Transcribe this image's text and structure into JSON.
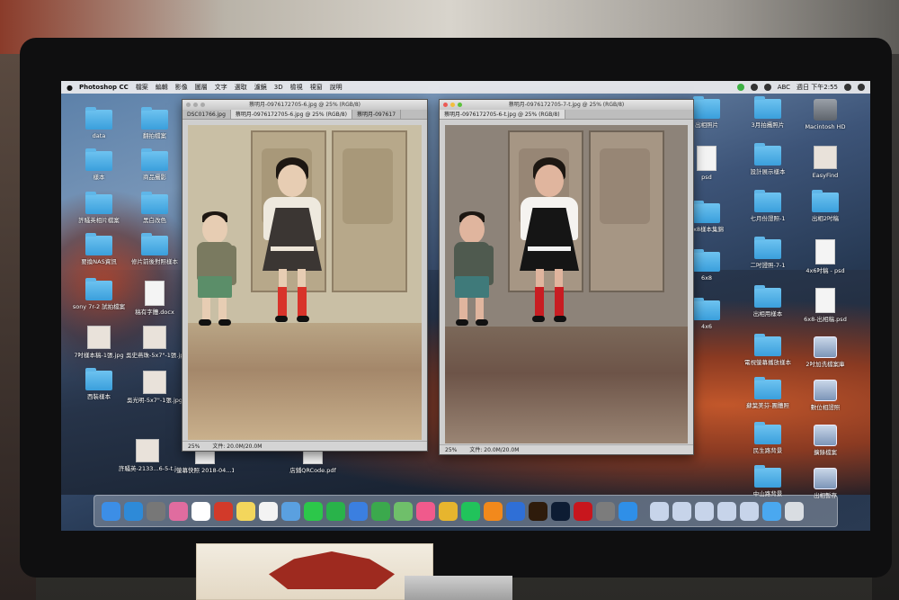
{
  "menubar": {
    "app_name": "Photoshop CC",
    "items": [
      "檔案",
      "編輯",
      "影像",
      "圖層",
      "文字",
      "選取",
      "濾鏡",
      "3D",
      "檢視",
      "視窗",
      "說明"
    ],
    "status_text": "週日 下午2:55",
    "input_label": "ABC"
  },
  "desktop_left": [
    {
      "label": "data",
      "kind": "folder"
    },
    {
      "label": "翻拍檔案",
      "kind": "folder"
    },
    {
      "label": "樣本",
      "kind": "folder"
    },
    {
      "label": "商品攝影",
      "kind": "folder"
    },
    {
      "label": "許騷英相片檔案",
      "kind": "folder"
    },
    {
      "label": "黑白改色",
      "kind": "folder"
    },
    {
      "label": "要換NAS資訊",
      "kind": "folder"
    },
    {
      "label": "修片前後對照樣本",
      "kind": "folder"
    },
    {
      "label": "sony 7r-2 試拍檔案",
      "kind": "folder"
    },
    {
      "label": "稿有字體.docx",
      "kind": "doc"
    },
    {
      "label": "7吋樣本稿-1張.jpg",
      "kind": "thumb"
    },
    {
      "label": "吳史燕珠-5x7\"-1張.jpg",
      "kind": "thumb"
    },
    {
      "label": "西裝樣本",
      "kind": "folder"
    },
    {
      "label": "吳光明-5x7\"-1張.jpg",
      "kind": "thumb"
    },
    {
      "label": "許騷英-2133...6-5-t.jpg",
      "kind": "thumb"
    },
    {
      "label": "螢幕快照 2018-04...1.38.png",
      "kind": "doc"
    },
    {
      "label": "店鋪QRCode.pdf",
      "kind": "doc"
    }
  ],
  "desktop_right": [
    {
      "label": "出相照片",
      "kind": "folder"
    },
    {
      "label": "3月拍攝照片",
      "kind": "folder"
    },
    {
      "label": "Macintosh HD",
      "kind": "drive"
    },
    {
      "label": "psd",
      "kind": "doc"
    },
    {
      "label": "設計展示樣本",
      "kind": "folder"
    },
    {
      "label": "EasyFind",
      "kind": "thumb"
    },
    {
      "label": "6x8樣本集錦",
      "kind": "folder"
    },
    {
      "label": "七月份證照-1",
      "kind": "folder"
    },
    {
      "label": "出相2吋稿",
      "kind": "folder"
    },
    {
      "label": "6x8",
      "kind": "folder"
    },
    {
      "label": "二吋證照-7-1",
      "kind": "folder"
    },
    {
      "label": "4x6吋稿 - psd",
      "kind": "doc"
    },
    {
      "label": "4x6",
      "kind": "folder"
    },
    {
      "label": "出相用樣本",
      "kind": "folder"
    },
    {
      "label": "6x8-出相稿.psd",
      "kind": "doc"
    },
    {
      "label": "電視螢幕播放樣本",
      "kind": "folder"
    },
    {
      "label": "2吋加洗檔案庫",
      "kind": "netvol"
    },
    {
      "label": "蘇葉美芬-團體照",
      "kind": "folder"
    },
    {
      "label": "數位相證照",
      "kind": "netvol"
    },
    {
      "label": "民生路背景",
      "kind": "folder"
    },
    {
      "label": "擴錄檔案",
      "kind": "netvol"
    },
    {
      "label": "中山路背景",
      "kind": "folder"
    },
    {
      "label": "出相暫存",
      "kind": "netvol"
    }
  ],
  "window_left": {
    "title": "蔡明月-0976172705-6.jpg @ 25% (RGB/8)",
    "tabs": [
      "DSC01766.jpg",
      "蔡明月-0976172705-6.jpg @ 25% (RGB/8)",
      "蔡明月-097617"
    ],
    "zoom": "25%",
    "doc_info": "文件: 20.0M/20.0M"
  },
  "window_right": {
    "title": "蔡明月-0976172705-7-t.jpg @ 25% (RGB/8)",
    "tabs": [
      "蔡明月-0976172705-6-t.jpg @ 25% (RGB/8)"
    ],
    "zoom": "25%",
    "doc_info": "文件: 20.0M/20.0M"
  },
  "dock": {
    "apps": [
      "finder-icon",
      "safari-icon",
      "launchpad-icon",
      "photos-icon",
      "calendar-icon",
      "acrobat-icon",
      "notes-icon",
      "reminders-icon",
      "preview-icon",
      "messages-icon",
      "facetime-icon",
      "keynote-icon",
      "numbers-icon",
      "maps-icon",
      "music-icon",
      "chrome-icon",
      "line-icon",
      "ibooks-icon",
      "quicktime-icon",
      "illustrator-icon",
      "photoshop-icon",
      "filezilla-icon",
      "system-preferences-icon",
      "appstore-icon",
      "network-1-icon",
      "network-2-icon",
      "network-3-icon",
      "network-4-icon",
      "network-5-icon",
      "downloads-icon",
      "trash-icon"
    ],
    "app_colors": [
      "#3c8ee6",
      "#2e8ad8",
      "#777777",
      "#e06c9f",
      "#ffffff",
      "#d23a2a",
      "#f3d65c",
      "#f3f3f3",
      "#5aa0e0",
      "#2cc74a",
      "#29b34a",
      "#3b7fe0",
      "#3ba94d",
      "#6fbf6a",
      "#f05a8c",
      "#e7b52e",
      "#21c35b",
      "#f2891c",
      "#2f6fd6",
      "#2e1b0b",
      "#0d1c33",
      "#c8161d",
      "#7c7c7c",
      "#2f8fe8",
      "#c7d4ea",
      "#c7d4ea",
      "#c7d4ea",
      "#c7d4ea",
      "#c7d4ea",
      "#4aa8f0",
      "#d9dde2"
    ]
  }
}
